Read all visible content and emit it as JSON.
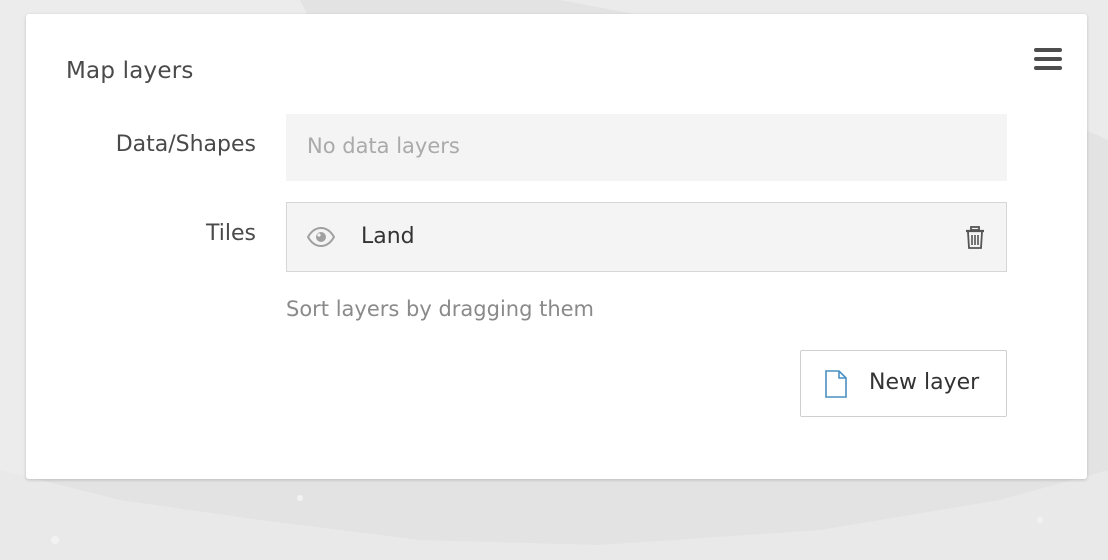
{
  "panel": {
    "title": "Map layers",
    "menu_icon": "hamburger-menu-icon"
  },
  "data_shapes": {
    "label": "Data/Shapes",
    "empty_text": "No data layers"
  },
  "tiles": {
    "label": "Tiles",
    "items": [
      {
        "name": "Land",
        "visibility_icon": "eye-icon",
        "delete_icon": "trash-icon"
      }
    ]
  },
  "hint": "Sort layers by dragging them",
  "new_layer_button": {
    "label": "New layer",
    "icon": "document-icon"
  },
  "colors": {
    "background": "#e6e6e6",
    "panel": "#ffffff",
    "row_fill": "#f4f4f4",
    "doc_icon_accent": "#4a90c2"
  }
}
